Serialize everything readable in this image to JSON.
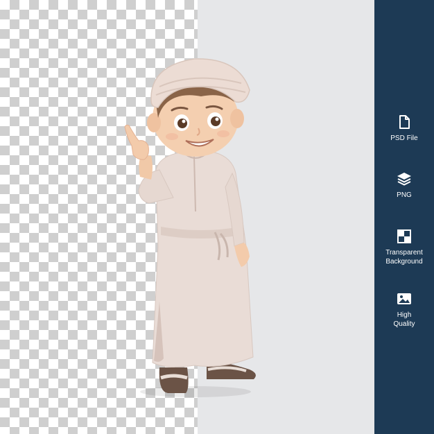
{
  "sidebar": {
    "background": "#1d3a55",
    "features": [
      {
        "icon": "file-icon",
        "label": "PSD File"
      },
      {
        "icon": "layers-icon",
        "label": "PNG"
      },
      {
        "icon": "checkerboard-icon",
        "label": "Transparent\nBackground"
      },
      {
        "icon": "image-icon",
        "label": "High\nQuality"
      }
    ]
  },
  "preview": {
    "checker_colors": [
      "#ffffff",
      "#cfcfcf"
    ],
    "solid_background": "#e6e7e9"
  }
}
